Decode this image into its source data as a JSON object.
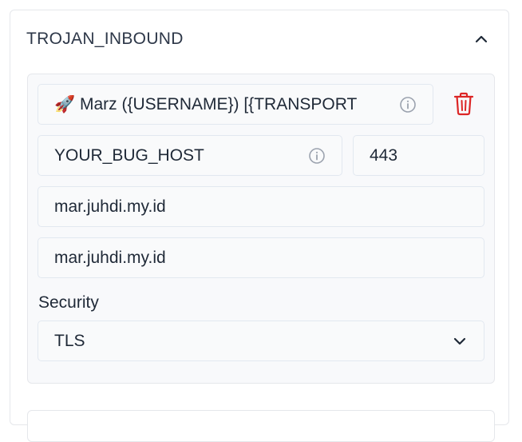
{
  "section": {
    "title": "TROJAN_INBOUND",
    "collapse_icon": "chevron-up-icon"
  },
  "host": {
    "remark_value": "🚀 Marz ({USERNAME}) [{TRANSPORT",
    "remark_icon": "info-icon",
    "delete_icon": "trash-icon",
    "address_value": "YOUR_BUG_HOST",
    "address_icon": "info-icon",
    "port_value": "443",
    "sni_value": "mar.juhdi.my.id",
    "host_header_value": "mar.juhdi.my.id",
    "security_label": "Security",
    "security_value": "TLS",
    "security_icon": "chevron-down-icon"
  },
  "colors": {
    "delete_red": "#dc2626",
    "icon_gray": "#9ca3af",
    "text": "#1f2937"
  }
}
